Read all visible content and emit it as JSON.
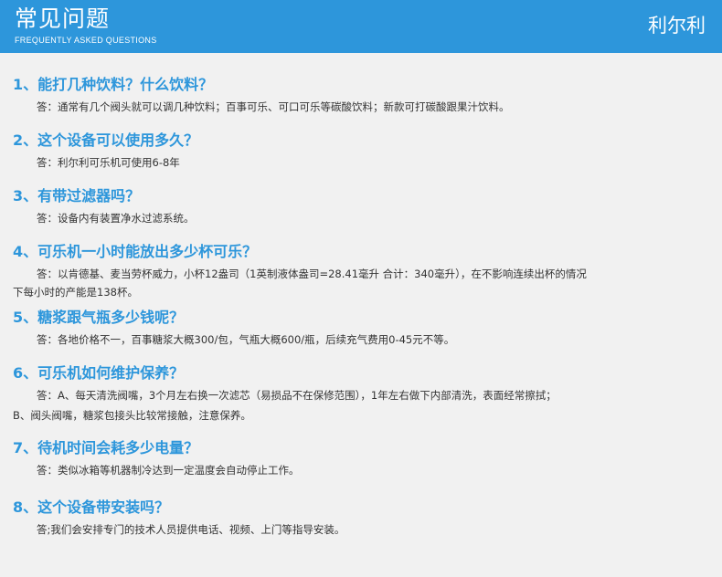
{
  "header": {
    "title": "常见问题",
    "subtitle": "FREQUENTLY ASKED QUESTIONS",
    "brand": "利尔利"
  },
  "faqs": [
    {
      "question": "1、能打几种饮料？什么饮料？",
      "answer": [
        "答：通常有几个阀头就可以调几种饮料；百事可乐、可口可乐等碳酸饮料；新款可打碳酸跟果汁饮料。"
      ]
    },
    {
      "question": "2、这个设备可以使用多久？",
      "answer": [
        "答：利尔利可乐机可使用6-8年"
      ]
    },
    {
      "question": "3、有带过滤器吗？",
      "answer": [
        "答：设备内有装置净水过滤系统。"
      ]
    },
    {
      "question": "4、可乐机一小时能放出多少杯可乐？",
      "answer": [
        "答：以肯德基、麦当劳杯威力，小杯12盎司（1英制液体盎司=28.41毫升 合计：340毫升），在不影响连续出杯的情况",
        "下每小时的产能是138杯。"
      ]
    },
    {
      "question": "5、糖浆跟气瓶多少钱呢？",
      "answer": [
        "答：各地价格不一，百事糖浆大概300/包，气瓶大概600/瓶，后续充气费用0-45元不等。"
      ]
    },
    {
      "question": "6、可乐机如何维护保养？",
      "answer": [
        "答：A、每天清洗阀嘴，3个月左右换一次滤芯（易损品不在保修范围），1年左右做下内部清洗，表面经常擦拭；",
        "B、阀头阀嘴，糖浆包接头比较常接触，注意保养。"
      ]
    },
    {
      "question": "7、待机时间会耗多少电量？",
      "answer": [
        "答：类似冰箱等机器制冷达到一定温度会自动停止工作。"
      ]
    },
    {
      "question": "8、这个设备带安装吗？",
      "answer": [
        "答;我们会安排专门的技术人员提供电话、视频、上门等指导安装。"
      ]
    }
  ]
}
